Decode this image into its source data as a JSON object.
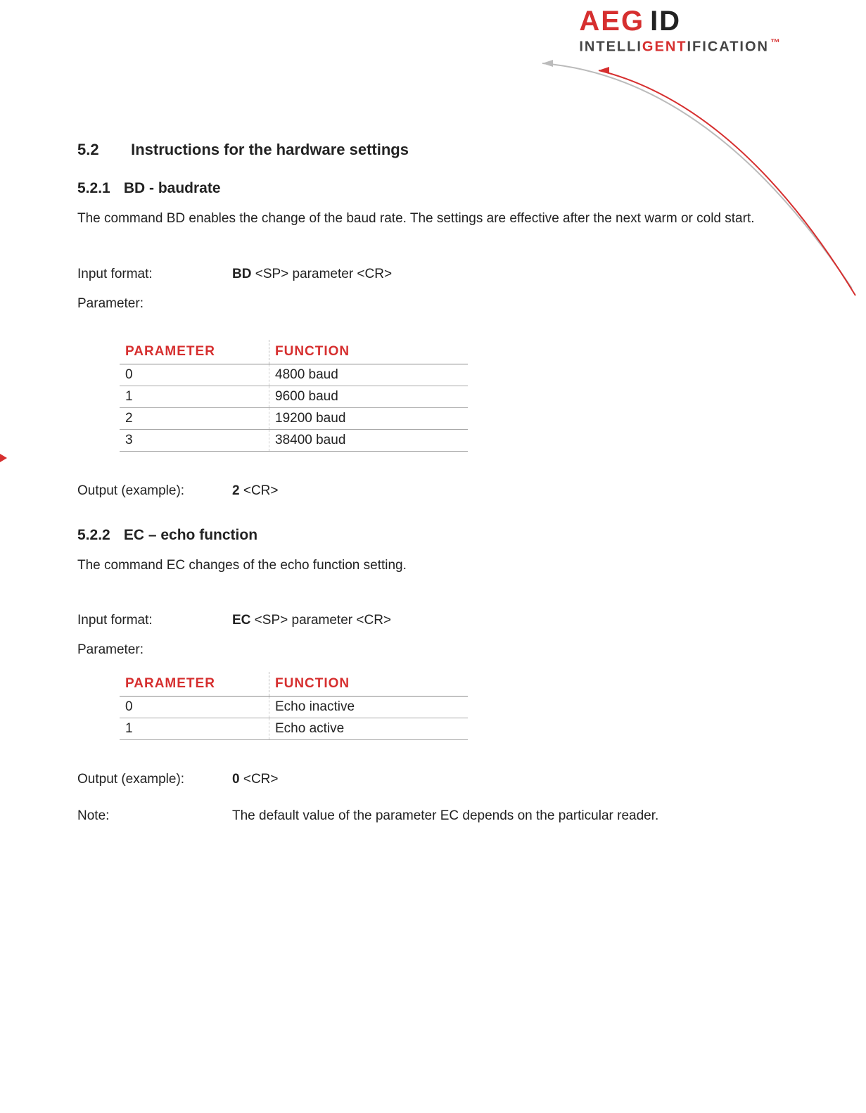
{
  "logo": {
    "aeg": "AEG",
    "id": "ID",
    "intelli": "INTELLI",
    "gent": "GENT",
    "ification": "IFICATION",
    "tm": "™"
  },
  "section": {
    "number": "5.2",
    "title": "Instructions for the hardware settings"
  },
  "sub1": {
    "number": "5.2.1",
    "title": "BD - baudrate",
    "desc": "The command BD enables the change of the baud rate. The settings are effective after the next warm or cold start.",
    "input_label": "Input format:",
    "input_cmd": "BD",
    "input_rest": " <SP> parameter <CR>",
    "param_label": "Parameter:",
    "table": {
      "headers": {
        "p": "PARAMETER",
        "f": "FUNCTION"
      },
      "rows": [
        {
          "p": "0",
          "f": "4800 baud"
        },
        {
          "p": "1",
          "f": "9600 baud"
        },
        {
          "p": "2",
          "f": "19200 baud"
        },
        {
          "p": "3",
          "f": "38400 baud"
        }
      ]
    },
    "output_label": "Output (example):",
    "output_cmd": "2",
    "output_rest": " <CR>"
  },
  "sub2": {
    "number": "5.2.2",
    "title": "EC – echo function",
    "desc": "The command EC changes of the echo function setting.",
    "input_label": "Input format:",
    "input_cmd": "EC",
    "input_rest": " <SP> parameter <CR>",
    "param_label": "Parameter:",
    "table": {
      "headers": {
        "p": "PARAMETER",
        "f": "FUNCTION"
      },
      "rows": [
        {
          "p": "0",
          "f": "Echo inactive"
        },
        {
          "p": "1",
          "f": "Echo active"
        }
      ]
    },
    "output_label": "Output (example):",
    "output_cmd": "0",
    "output_rest": " <CR>",
    "note_label": "Note:",
    "note_text": "The default value of the parameter EC depends on the particular reader."
  }
}
